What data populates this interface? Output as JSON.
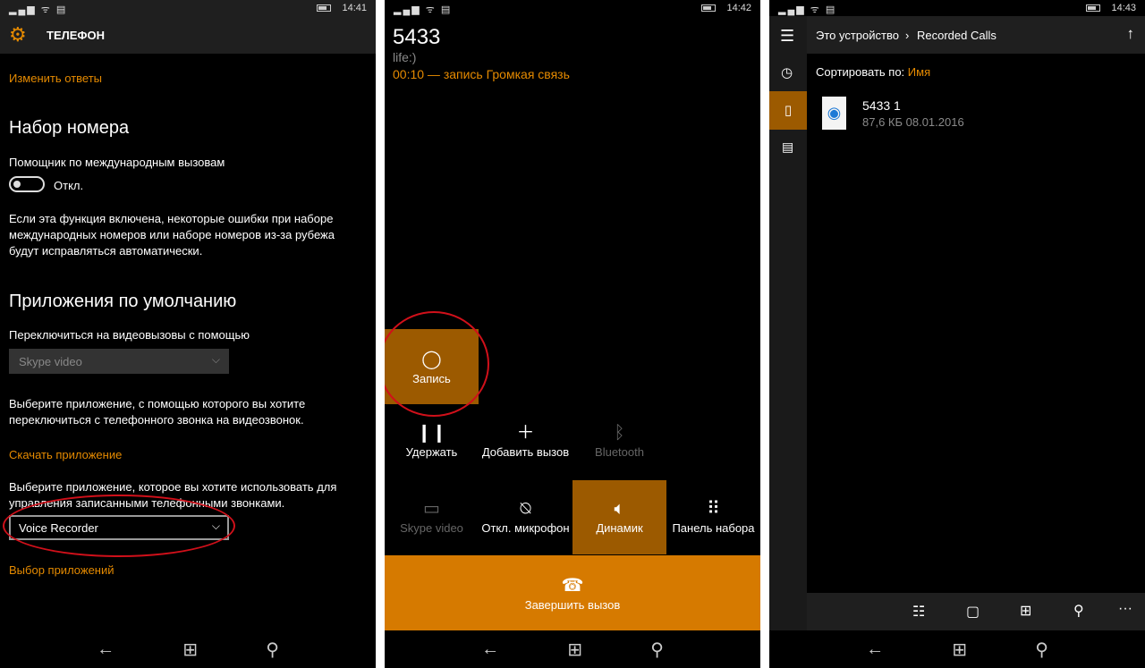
{
  "screen1": {
    "status": {
      "time": "14:41"
    },
    "header": {
      "title": "ТЕЛЕФОН",
      "icon": "gear-icon"
    },
    "change_replies_link": "Изменить ответы",
    "dialing": {
      "heading": "Набор номера",
      "assistant_label": "Помощник по международным вызовам",
      "toggle_state": "Откл.",
      "toggle_on": false,
      "description": "Если эта функция включена, некоторые ошибки при наборе международных номеров или наборе номеров из-за рубежа будут исправляться автоматически."
    },
    "defaults": {
      "heading": "Приложения по умолчанию",
      "video_label": "Переключиться на видеовызовы с помощью",
      "video_select": "Skype video",
      "video_desc": "Выберите приложение, с помощью которого вы хотите переключиться с телефонного звонка на видеозвонок.",
      "download_link": "Скачать приложение",
      "recorder_desc": "Выберите приложение, которое вы хотите использовать для управления записанными телефонными звонками.",
      "recorder_select": "Voice Recorder",
      "choose_link": "Выбор приложений"
    }
  },
  "screen2": {
    "status": {
      "time": "14:42"
    },
    "caller": {
      "number": "5433",
      "operator": "life:)",
      "call_status": "00:10 — запись Громкая связь"
    },
    "buttons": {
      "record": "Запись",
      "hold": "Удержать",
      "add_call": "Добавить вызов",
      "bluetooth": "Bluetooth",
      "skype_video": "Skype video",
      "mute": "Откл. микрофон",
      "speaker": "Динамик",
      "keypad": "Панель набора",
      "end_call": "Завершить вызов"
    }
  },
  "screen3": {
    "status": {
      "time": "14:43"
    },
    "breadcrumb": {
      "root": "Это устройство",
      "separator": "›",
      "current": "Recorded Calls"
    },
    "sort": {
      "label": "Сортировать по:",
      "value": "Имя"
    },
    "files": [
      {
        "name": "5433 1",
        "meta": "87,6 КБ 08.01.2016"
      }
    ],
    "bottom_icons": [
      "select-icon",
      "new-folder-icon",
      "view-icon",
      "search-icon",
      "more-icon"
    ],
    "more_label": "···"
  },
  "colors": {
    "accent": "#e58a00",
    "tile": "#9c5a00",
    "end_call": "#d67a00",
    "annotation": "#d0101a"
  }
}
